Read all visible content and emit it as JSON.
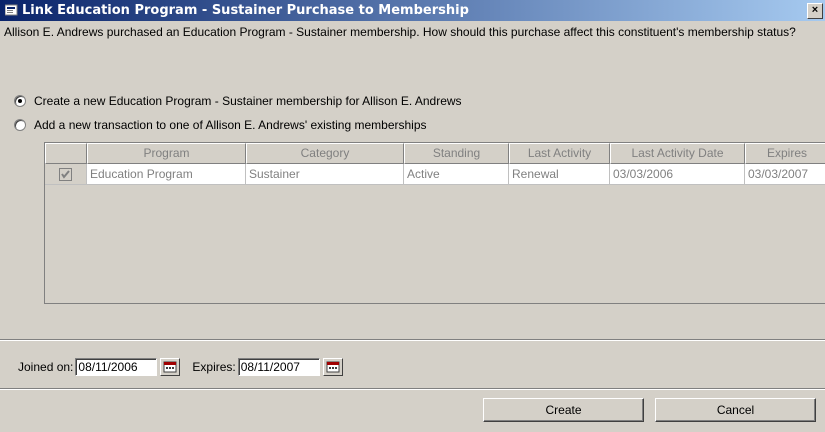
{
  "window": {
    "title": "Link Education Program - Sustainer Purchase to Membership",
    "close_label": "×"
  },
  "prompt": "Allison E. Andrews purchased an Education Program - Sustainer membership.  How should this purchase affect this constituent's membership status?",
  "options": {
    "create_new": {
      "label": "Create a new Education Program - Sustainer membership for Allison E. Andrews",
      "selected": true
    },
    "add_existing": {
      "label": "Add a new transaction to one of Allison E. Andrews' existing memberships",
      "selected": false
    }
  },
  "grid": {
    "columns": [
      "Program",
      "Category",
      "Standing",
      "Last Activity",
      "Last Activity Date",
      "Expires"
    ],
    "rows": [
      {
        "checked": true,
        "program": "Education Program",
        "category": "Sustainer",
        "standing": "Active",
        "last_activity": "Renewal",
        "last_activity_date": "03/03/2006",
        "expires": "03/03/2007"
      }
    ]
  },
  "dates": {
    "joined_label": "Joined on:",
    "joined_value": "08/11/2006",
    "expires_label": "Expires:",
    "expires_value": "08/11/2007"
  },
  "buttons": {
    "create": "Create",
    "cancel": "Cancel"
  },
  "colors": {
    "titlebar_start": "#0a246a",
    "titlebar_end": "#a6caf0",
    "face": "#d4d0c8"
  }
}
